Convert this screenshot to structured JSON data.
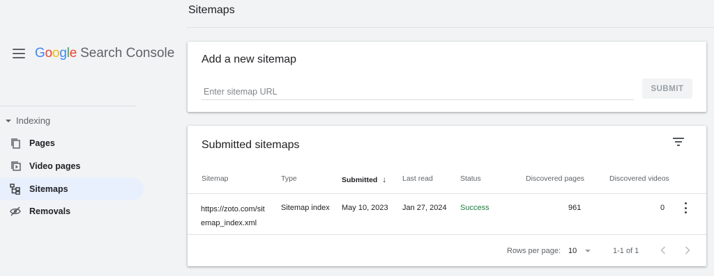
{
  "header": {
    "page_title": "Sitemaps"
  },
  "sidebar": {
    "brand_parts": [
      "G",
      "o",
      "o",
      "g",
      "l",
      "e"
    ],
    "product_name": "Search Console",
    "section_label": "Indexing",
    "items": [
      {
        "label": "Pages",
        "icon": "pages-icon",
        "active": false
      },
      {
        "label": "Video pages",
        "icon": "video-pages-icon",
        "active": false
      },
      {
        "label": "Sitemaps",
        "icon": "sitemaps-icon",
        "active": true
      },
      {
        "label": "Removals",
        "icon": "removals-icon",
        "active": false
      }
    ]
  },
  "add_sitemap": {
    "title": "Add a new sitemap",
    "input_placeholder": "Enter sitemap URL",
    "input_value": "",
    "submit_label": "SUBMIT"
  },
  "submitted": {
    "title": "Submitted sitemaps",
    "columns": [
      "Sitemap",
      "Type",
      "Submitted",
      "Last read",
      "Status",
      "Discovered pages",
      "Discovered videos"
    ],
    "sort_indicator": "↓",
    "rows": [
      {
        "sitemap_line1": "https://zoto.com/sit",
        "sitemap_line2": "emap_index.xml",
        "type": "Sitemap index",
        "submitted": "May 10, 2023",
        "last_read": "Jan 27, 2024",
        "status": "Success",
        "discovered_pages": "961",
        "discovered_videos": "0"
      }
    ],
    "footer": {
      "rows_per_page_label": "Rows per page:",
      "rows_per_page_value": "10",
      "range_text": "1-1 of 1"
    }
  },
  "colors": {
    "accent": "#1a73e8",
    "active_nav_bg": "#e8f0fe",
    "success": "#188038"
  }
}
